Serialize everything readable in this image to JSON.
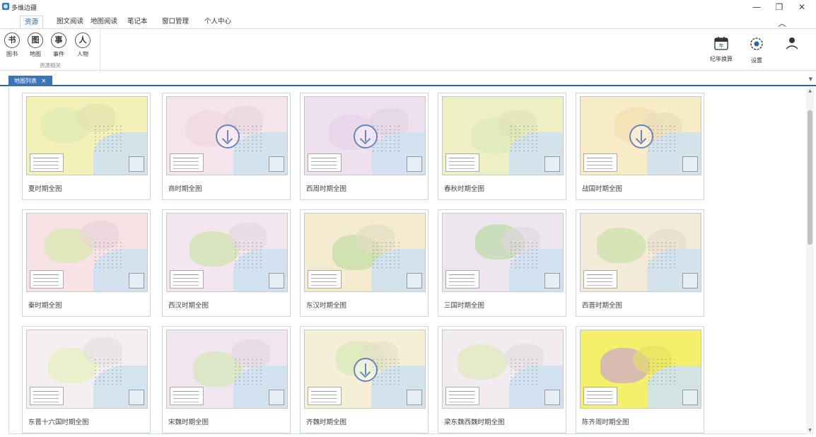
{
  "app": {
    "title": "多维边疆"
  },
  "window": {
    "minimize": "—",
    "restore": "❐",
    "close": "✕",
    "collapse": "︿"
  },
  "menu": {
    "tabs": [
      {
        "label": "资源",
        "active": true
      },
      {
        "label": "图文阅读"
      },
      {
        "label": "地图阅读"
      },
      {
        "label": "笔记本"
      },
      {
        "label": "窗口管理"
      },
      {
        "label": "个人中心"
      }
    ]
  },
  "ribbon": {
    "group_label": "资源相关",
    "buttons": [
      {
        "glyph": "书",
        "label": "图书"
      },
      {
        "glyph": "图",
        "label": "地图"
      },
      {
        "glyph": "事",
        "label": "事件"
      },
      {
        "glyph": "人",
        "label": "人物"
      }
    ],
    "right": [
      {
        "icon": "calendar-icon",
        "label": "纪年换算",
        "calendar_text": "年"
      },
      {
        "icon": "gear-icon",
        "label": "设置"
      },
      {
        "icon": "user-icon",
        "label": ""
      }
    ]
  },
  "doc_tab": {
    "label": "地图列表",
    "close": "×"
  },
  "maps": [
    {
      "title": "夏时期全图",
      "palette": [
        "#f3f0b8",
        "#dfe9b5"
      ],
      "downloadable": false
    },
    {
      "title": "商时期全图",
      "palette": [
        "#f6e4ec",
        "#f0d6e2"
      ],
      "downloadable": true
    },
    {
      "title": "西周时期全图",
      "palette": [
        "#efe0ef",
        "#e6d3e8"
      ],
      "downloadable": true
    },
    {
      "title": "春秋时期全图",
      "palette": [
        "#eef0c4",
        "#dbe8b8"
      ],
      "downloadable": false
    },
    {
      "title": "战国时期全图",
      "palette": [
        "#f8ecc7",
        "#f2dfb0"
      ],
      "downloadable": true
    },
    {
      "title": "秦时期全图",
      "palette": [
        "#f7e2e6",
        "#d9e9a8"
      ],
      "downloadable": false
    },
    {
      "title": "西汉时期全图",
      "palette": [
        "#f3e6ef",
        "#c9e2a4"
      ],
      "downloadable": false
    },
    {
      "title": "东汉时期全图",
      "palette": [
        "#f4ebd0",
        "#bfdc9e"
      ],
      "downloadable": false
    },
    {
      "title": "三国时期全图",
      "palette": [
        "#eee6ef",
        "#b7d8a2"
      ],
      "downloadable": false
    },
    {
      "title": "西晋时期全图",
      "palette": [
        "#f4ead8",
        "#c8e0a6"
      ],
      "downloadable": false
    },
    {
      "title": "东晋十六国时期全图",
      "palette": [
        "#f5eef0",
        "#e4f0b8"
      ],
      "downloadable": false
    },
    {
      "title": "宋魏时期全图",
      "palette": [
        "#f1e6ef",
        "#d3e8b0"
      ],
      "downloadable": false
    },
    {
      "title": "齐魏时期全图",
      "palette": [
        "#f4efd6",
        "#d6e8b4"
      ],
      "downloadable": true
    },
    {
      "title": "梁东魏西魏时期全图",
      "palette": [
        "#f2ebef",
        "#dde9b6"
      ],
      "downloadable": false
    },
    {
      "title": "陈齐周时期全图",
      "palette": [
        "#f5f06a",
        "#c89fd6"
      ],
      "downloadable": false
    }
  ]
}
